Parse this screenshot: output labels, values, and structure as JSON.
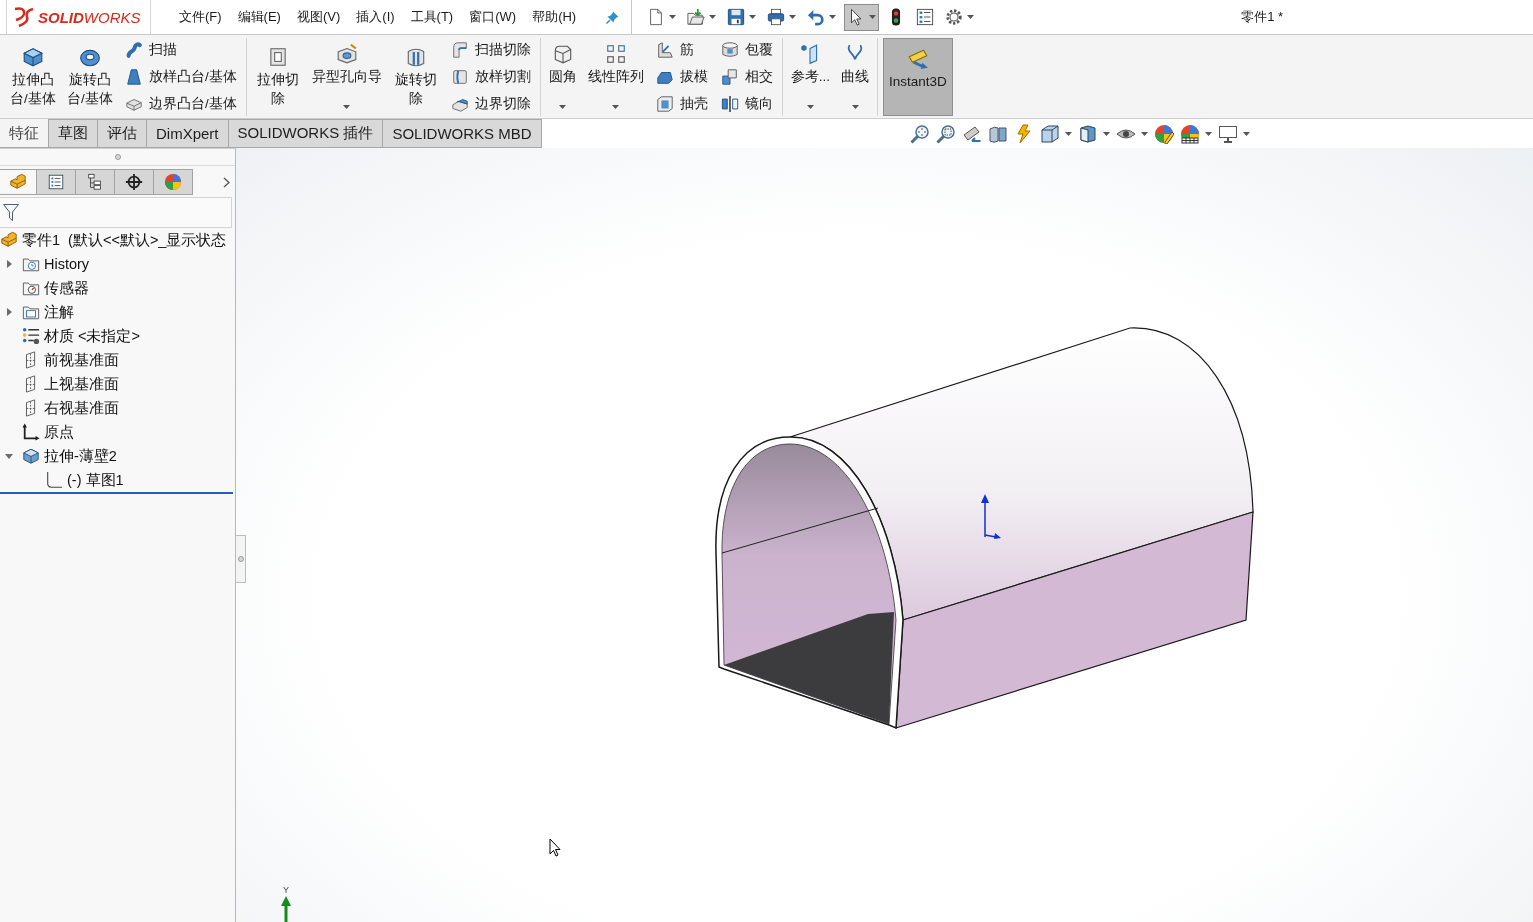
{
  "title_bar": {
    "logo_text": "**SOLID**WORKS",
    "menu": [
      "文件(F)",
      "编辑(E)",
      "视图(V)",
      "插入(I)",
      "工具(T)",
      "窗口(W)",
      "帮助(H)"
    ],
    "quick_access": [
      {
        "dropdown": true,
        "pressed": false
      },
      {
        "dropdown": true,
        "pressed": false
      },
      {
        "dropdown": true,
        "pressed": false
      },
      {
        "dropdown": true,
        "pressed": false
      },
      {
        "dropdown": true,
        "pressed": false
      },
      {
        "dropdown": true,
        "pressed": true
      },
      {
        "dropdown": false,
        "pressed": false
      },
      {
        "dropdown": false,
        "pressed": false
      },
      {
        "dropdown": true,
        "pressed": false
      }
    ],
    "document_title": "零件1 *"
  },
  "ribbon": {
    "groups": [
      {
        "items": [
          {
            "kind": "large",
            "label": "拉伸凸台/基体",
            "dropdown": false
          },
          {
            "kind": "large",
            "label": "旋转凸台/基体",
            "dropdown": false
          },
          {
            "kind": "stack",
            "buttons": [
              {
                "label": "扫描"
              },
              {
                "label": "放样凸台/基体"
              },
              {
                "label": "边界凸台/基体"
              }
            ]
          }
        ]
      },
      {
        "items": [
          {
            "kind": "large",
            "label": "拉伸切除",
            "dropdown": false
          },
          {
            "kind": "large",
            "label": "异型孔向导",
            "dropdown": true
          },
          {
            "kind": "large",
            "label": "旋转切除",
            "dropdown": false
          },
          {
            "kind": "stack",
            "buttons": [
              {
                "label": "扫描切除"
              },
              {
                "label": "放样切割"
              },
              {
                "label": "边界切除"
              }
            ]
          }
        ]
      },
      {
        "items": [
          {
            "kind": "large",
            "label": "圆角",
            "dropdown": true
          },
          {
            "kind": "large",
            "label": "线性阵列",
            "dropdown": true
          },
          {
            "kind": "stack",
            "buttons": [
              {
                "label": "筋"
              },
              {
                "label": "拔模"
              },
              {
                "label": "抽壳"
              }
            ]
          },
          {
            "kind": "stack",
            "buttons": [
              {
                "label": "包覆"
              },
              {
                "label": "相交"
              },
              {
                "label": "镜向"
              }
            ]
          }
        ]
      },
      {
        "items": [
          {
            "kind": "large",
            "label": "参考...",
            "dropdown": true
          },
          {
            "kind": "large",
            "label": "曲线",
            "dropdown": true
          }
        ]
      },
      {
        "items": [
          {
            "kind": "toggle",
            "label": "Instant3D",
            "pressed": true
          }
        ]
      }
    ]
  },
  "command_tabs": [
    {
      "label": "特征",
      "selected": true
    },
    {
      "label": "草图",
      "selected": false
    },
    {
      "label": "评估",
      "selected": false
    },
    {
      "label": "DimXpert",
      "selected": false
    },
    {
      "label": "SOLIDWORKS 插件",
      "selected": false
    },
    {
      "label": "SOLIDWORKS MBD",
      "selected": false
    }
  ],
  "view_toolbar": [
    {
      "dropdown": false
    },
    {
      "dropdown": false
    },
    {
      "dropdown": false
    },
    {
      "dropdown": false
    },
    {
      "dropdown": false
    },
    {
      "dropdown": true
    },
    {
      "dropdown": true
    },
    {
      "dropdown": true
    },
    {
      "dropdown": false
    },
    {
      "dropdown": true
    },
    {
      "dropdown": true
    }
  ],
  "feature_manager": {
    "tabs": [
      {
        "selected": true
      },
      {
        "selected": false
      },
      {
        "selected": false
      },
      {
        "selected": false
      },
      {
        "selected": false
      }
    ],
    "tree": [
      {
        "kind": "part",
        "label": "零件1  (默认<<默认>_显示状态",
        "children": [
          {
            "kind": "history",
            "label": "History",
            "expanded": false
          },
          {
            "kind": "sensors",
            "label": "传感器"
          },
          {
            "kind": "annotations",
            "label": "注解",
            "expanded": false
          },
          {
            "kind": "material",
            "label": "材质 <未指定>"
          },
          {
            "kind": "plane",
            "label": "前视基准面"
          },
          {
            "kind": "plane",
            "label": "上视基准面"
          },
          {
            "kind": "plane",
            "label": "右视基准面"
          },
          {
            "kind": "origin",
            "label": "原点"
          },
          {
            "kind": "feature",
            "label": "拉伸-薄壁2",
            "expanded": true,
            "children": [
              {
                "kind": "sketch",
                "label": "(-) 草图1"
              }
            ]
          }
        ]
      }
    ]
  },
  "viewport": {
    "triad_label": "Y"
  }
}
